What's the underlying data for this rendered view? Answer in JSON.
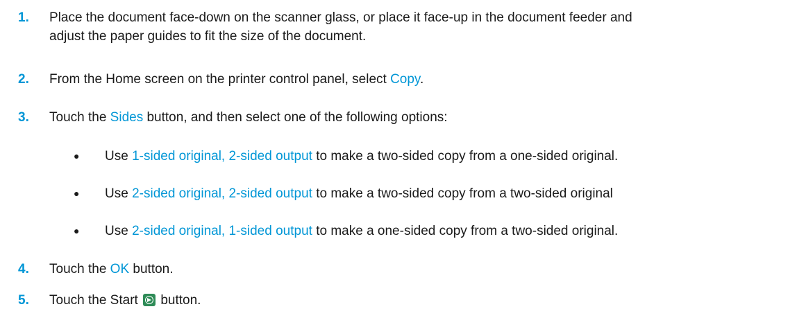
{
  "colors": {
    "accent": "#0096d6",
    "start_icon": "#2e8b57"
  },
  "steps": [
    {
      "num": "1.",
      "line1": "Place the document face-down on the scanner glass, or place it face-up in the document feeder and",
      "line2": "adjust the paper guides to fit the size of the document."
    },
    {
      "num": "2.",
      "pre": "From the Home screen on the printer control panel, select ",
      "link": "Copy",
      "post": "."
    },
    {
      "num": "3.",
      "pre": "Touch the ",
      "link": "Sides",
      "post": " button, and then select one of the following options:"
    },
    {
      "num": "4.",
      "pre": "Touch the ",
      "link": "OK",
      "post": " button."
    },
    {
      "num": "5.",
      "pre": "Touch the Start ",
      "icon": "start-icon",
      "post": " button."
    }
  ],
  "options": [
    {
      "bullet": "●",
      "pre": "Use ",
      "link": "1-sided original, 2-sided output",
      "post": " to make a two-sided copy from a one-sided original."
    },
    {
      "bullet": "●",
      "pre": "Use ",
      "link": "2-sided original, 2-sided output",
      "post": " to make a two-sided copy from a two-sided original"
    },
    {
      "bullet": "●",
      "pre": "Use ",
      "link": "2-sided original, 1-sided output",
      "post": " to make a one-sided copy from a two-sided original."
    }
  ]
}
